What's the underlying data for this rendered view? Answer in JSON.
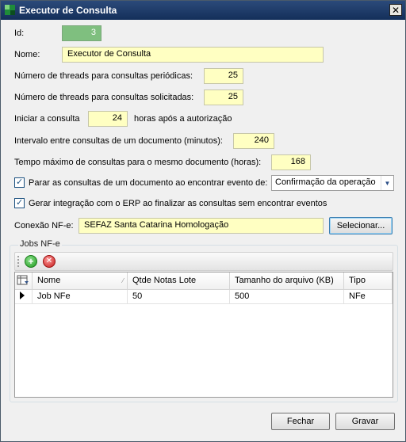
{
  "window": {
    "title": "Executor de Consulta",
    "close_glyph": "✕"
  },
  "form": {
    "id_label": "Id:",
    "id_value": "3",
    "nome_label": "Nome:",
    "nome_value": "Executor de Consulta",
    "threads_periodicas_label": "Número de threads para consultas periódicas:",
    "threads_periodicas_value": "25",
    "threads_solicitadas_label": "Número de threads para consultas solicitadas:",
    "threads_solicitadas_value": "25",
    "iniciar_label": "Iniciar a consulta",
    "iniciar_value": "24",
    "iniciar_suffix": "horas após a autorização",
    "intervalo_label": "Intervalo entre consultas de um documento (minutos):",
    "intervalo_value": "240",
    "tempo_maximo_label": "Tempo máximo de consultas para o mesmo documento (horas):",
    "tempo_maximo_value": "168",
    "parar_label": "Parar as consultas de um documento ao encontrar evento de:",
    "parar_checked": true,
    "parar_select_value": "Confirmação da operação",
    "gerar_label": "Gerar integração com o ERP ao finalizar as consultas sem encontrar eventos",
    "gerar_checked": true,
    "conexao_label": "Conexão NF-e:",
    "conexao_value": "SEFAZ Santa Catarina Homologação",
    "selecionar_label": "Selecionar..."
  },
  "jobs": {
    "group_title": "Jobs NF-e",
    "toolbar": {
      "add_icon": "add-icon",
      "delete_icon": "delete-icon"
    },
    "columns": [
      "Nome",
      "Qtde Notas Lote",
      "Tamanho do arquivo (KB)",
      "Tipo"
    ],
    "rows": [
      {
        "nome": "Job NFe",
        "qtde": "50",
        "tamanho": "500",
        "tipo": "NFe"
      }
    ]
  },
  "footer": {
    "fechar_label": "Fechar",
    "gravar_label": "Gravar"
  }
}
